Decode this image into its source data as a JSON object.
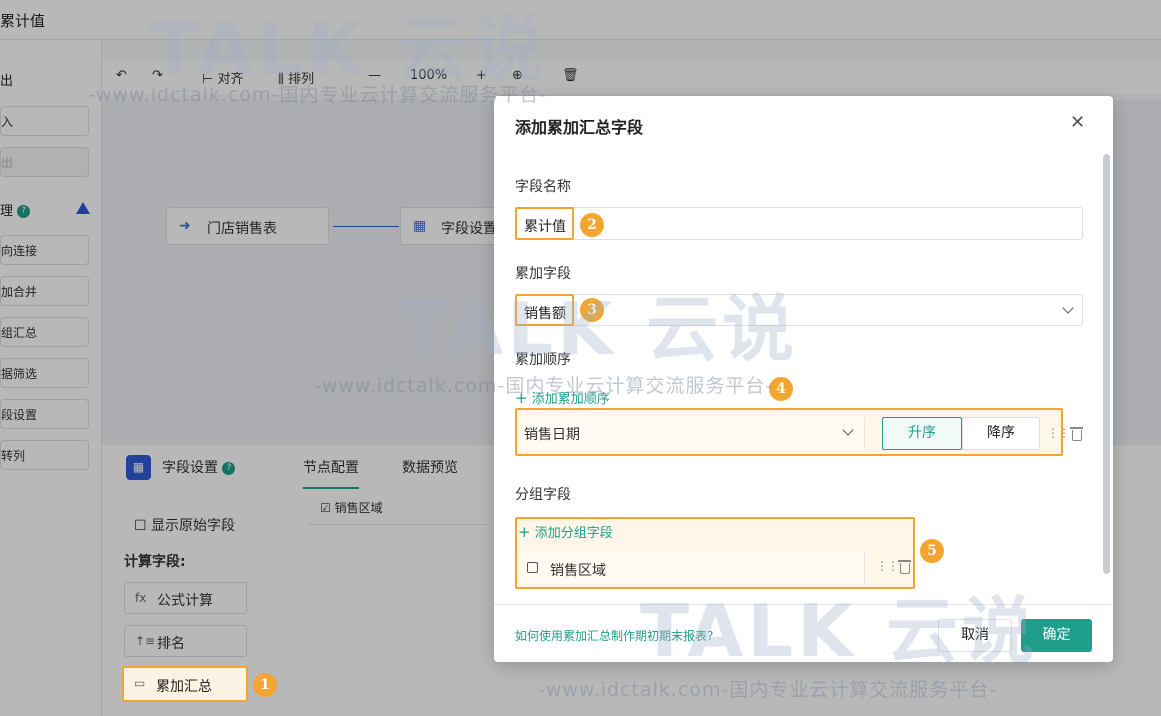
{
  "app": {
    "title": "累计值",
    "left_panel": {
      "section_output": "出",
      "btn_input": "入",
      "btn_output": "出",
      "section_process": "理",
      "items": [
        "向连接",
        "加合并",
        "组汇总",
        "据筛选",
        "段设置",
        "转列"
      ]
    },
    "toolbar": {
      "align": "对齐",
      "arrange": "排列",
      "zoom": "100%"
    },
    "canvas": {
      "node1": "门店销售表",
      "node2": "字段设置"
    },
    "bottom": {
      "panel_title": "字段设置",
      "tabs": [
        "节点配置",
        "数据预览"
      ],
      "show_original": "显示原始字段",
      "calc_fields_label": "计算字段:",
      "calc_buttons": [
        "公式计算",
        "排名",
        "累加汇总"
      ],
      "column_header": "销售区域"
    }
  },
  "dialog": {
    "title": "添加累加汇总字段",
    "field_name_label": "字段名称",
    "field_name_value": "累计值",
    "accum_field_label": "累加字段",
    "accum_field_value": "销售额",
    "accum_order_label": "累加顺序",
    "add_order_link": "添加累加顺序",
    "order_field": "销售日期",
    "asc_label": "升序",
    "desc_label": "降序",
    "group_label": "分组字段",
    "add_group_link": "添加分组字段",
    "group_field": "销售区域",
    "help_link": "如何使用累加汇总制作期初期末报表?",
    "cancel_label": "取消",
    "ok_label": "确定"
  },
  "badges": [
    "1",
    "2",
    "3",
    "4",
    "5"
  ],
  "watermark": {
    "logo": "TALK 云说",
    "url": "-www.idctalk.com-国内专业云计算交流服务平台-"
  },
  "colors": {
    "accent": "#1f9e8c",
    "highlight": "#f3a531",
    "primary_blue": "#2e5ad8"
  }
}
